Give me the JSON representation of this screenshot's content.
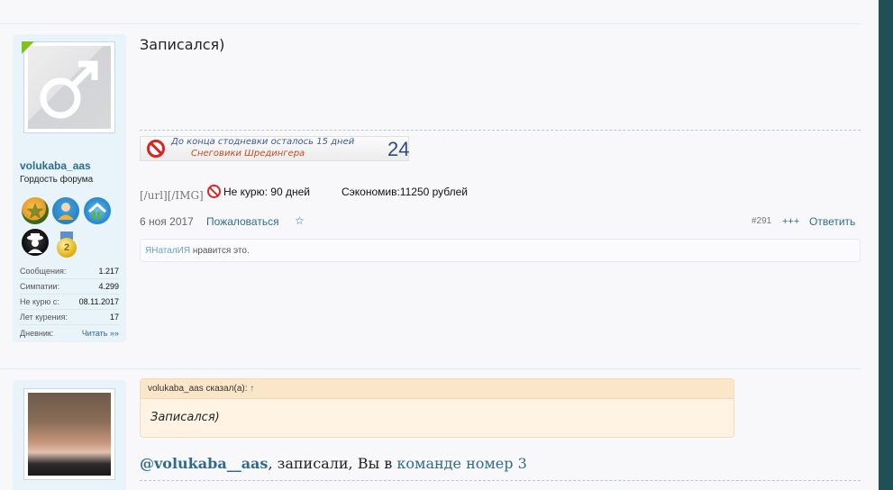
{
  "post1": {
    "username": "volukaba_aas",
    "user_title": "Гордость форума",
    "stats": [
      {
        "key": "Сообщения:",
        "value": "1.217"
      },
      {
        "key": "Симпатии:",
        "value": "4.299"
      },
      {
        "key": "Не курю с:",
        "value": "08.11.2017"
      },
      {
        "key": "Лет курения:",
        "value": "17"
      },
      {
        "key": "Дневник:",
        "value": "Читать »»"
      }
    ],
    "message": "Записался)",
    "ticker": {
      "line1": "До конца стодневки осталось 15 дней",
      "line2": "Снеговики Шредингера",
      "number": "24"
    },
    "sig_code": "[/url][/IMG]",
    "sig_nosmoke": "Не курю: 90 дней",
    "sig_savings": "Сэкономив:11250 рублей",
    "date": "6 ноя 2017",
    "report_label": "Пожаловаться",
    "star": "☆",
    "post_number": "#291",
    "more_label": "+++",
    "reply_label": "Ответить",
    "likes_user": "ЯНаталИЯ",
    "likes_text": " нравится это."
  },
  "post2": {
    "quote_author": "volukaba_aas сказал(а): ",
    "quote_arrow": "↑",
    "quote_text": "Записался)",
    "mention": "@volukaba__aas",
    "reply_middle": ", записали, Вы в ",
    "team_link": "команде номер 3"
  },
  "colors": {
    "accent_link": "#2f6b8f",
    "panel_bg": "#e8f3fa",
    "page_bg": "#f8f8fb",
    "quote_bg": "#fff4e4",
    "right_bar": "#1f5057",
    "online_indicator": "#7fc21e"
  },
  "icons": {
    "avatar_placeholder": "male-symbol-icon",
    "badges": [
      "trophy-star-badge-icon",
      "user-badge-icon",
      "house-badge-icon",
      "spy-badge-icon",
      "medal-2-icon"
    ],
    "no_smoking": "no-smoking-icon"
  }
}
